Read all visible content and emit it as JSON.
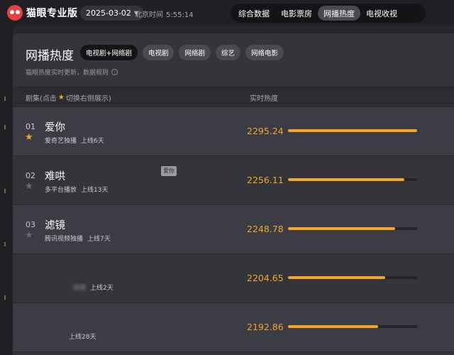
{
  "app": {
    "logo": "猫眼专业版",
    "date": "2025-03-02",
    "clock_label": "北京时间",
    "clock_time": "5:55:14"
  },
  "nav": {
    "tabs": [
      "综合数据",
      "电影票房",
      "网播热度",
      "电视收视"
    ],
    "active": 2
  },
  "panel": {
    "title": "网播热度",
    "chips": [
      "电视剧+网络剧",
      "电视剧",
      "网络剧",
      "综艺",
      "网络电影"
    ],
    "note": "猫眼热度实时更新，数据规则"
  },
  "table": {
    "col_name_prefix": "剧集(点击",
    "col_name_suffix": "切换右侧展示)",
    "col_heat": "实时热度"
  },
  "rows": [
    {
      "rank": "01",
      "title": "爱你",
      "platform": "爱奇艺独播",
      "online": "上线6天",
      "heat": "2295.24",
      "fill": 1.0,
      "starred": true
    },
    {
      "rank": "02",
      "title": "难哄",
      "platform": "多平台播放",
      "online": "上线13天",
      "heat": "2256.11",
      "fill": 0.9,
      "starred": false
    },
    {
      "rank": "03",
      "title": "滤镜",
      "platform": "腾讯视频独播",
      "online": "上线7天",
      "heat": "2248.78",
      "fill": 0.83,
      "starred": false
    },
    {
      "rank": "",
      "title": "",
      "platform": "独播",
      "online": "上线2天",
      "heat": "2204.65",
      "fill": 0.75,
      "starred": false
    },
    {
      "rank": "",
      "title": "",
      "platform": "",
      "online": "上线28天",
      "heat": "2192.86",
      "fill": 0.7,
      "starred": false
    }
  ],
  "tooltip": "爱你",
  "colors": {
    "accent": "#f5a623",
    "brand": "#e8403e"
  },
  "icons": {
    "logo": "cat-eye-logo-icon",
    "star": "star-icon",
    "info": "info-icon",
    "caret": "caret-down-icon"
  }
}
